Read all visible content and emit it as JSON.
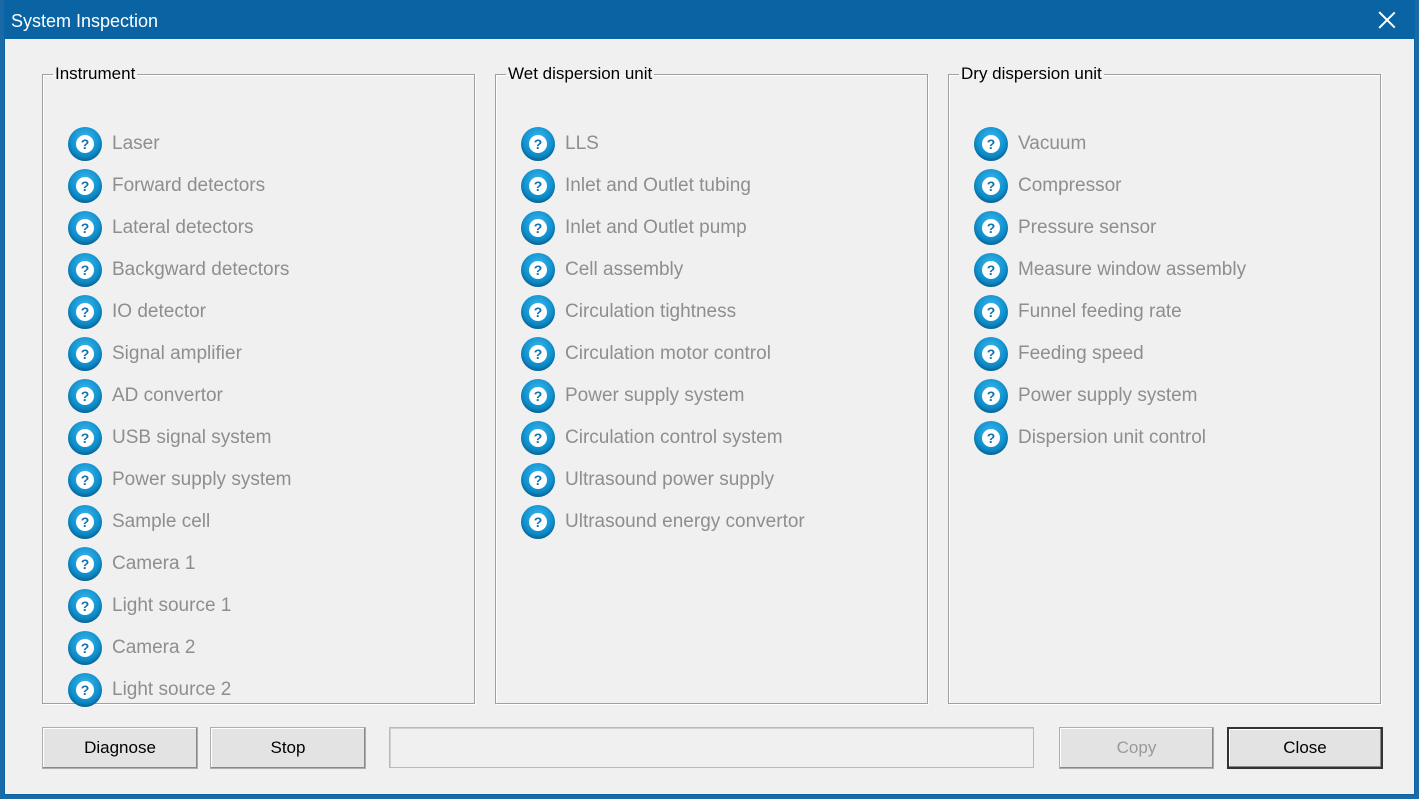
{
  "window": {
    "title": "System Inspection"
  },
  "groups": [
    {
      "label": "Instrument",
      "items": [
        "Laser",
        "Forward detectors",
        "Lateral detectors",
        "Backgward detectors",
        "IO detector",
        "Signal amplifier",
        "AD convertor",
        "USB signal system",
        "Power supply system",
        "Sample cell",
        "Camera 1",
        "Light source 1",
        "Camera 2",
        "Light source 2"
      ]
    },
    {
      "label": "Wet dispersion unit",
      "items": [
        "LLS",
        "Inlet and Outlet tubing",
        "Inlet and Outlet pump",
        "Cell assembly",
        "Circulation tightness",
        "Circulation motor control",
        "Power supply system",
        "Circulation control system",
        "Ultrasound power supply",
        "Ultrasound energy convertor"
      ]
    },
    {
      "label": "Dry dispersion unit",
      "items": [
        "Vacuum",
        "Compressor",
        "Pressure sensor",
        "Measure window assembly",
        "Funnel feeding rate",
        "Feeding speed",
        "Power supply system",
        "Dispersion unit control"
      ]
    }
  ],
  "status_icon": {
    "name": "question-icon",
    "glyph": "?",
    "color": "#0f8fcc"
  },
  "buttons": {
    "diagnose": "Diagnose",
    "stop": "Stop",
    "copy": "Copy",
    "close": "Close"
  },
  "status_text": ""
}
